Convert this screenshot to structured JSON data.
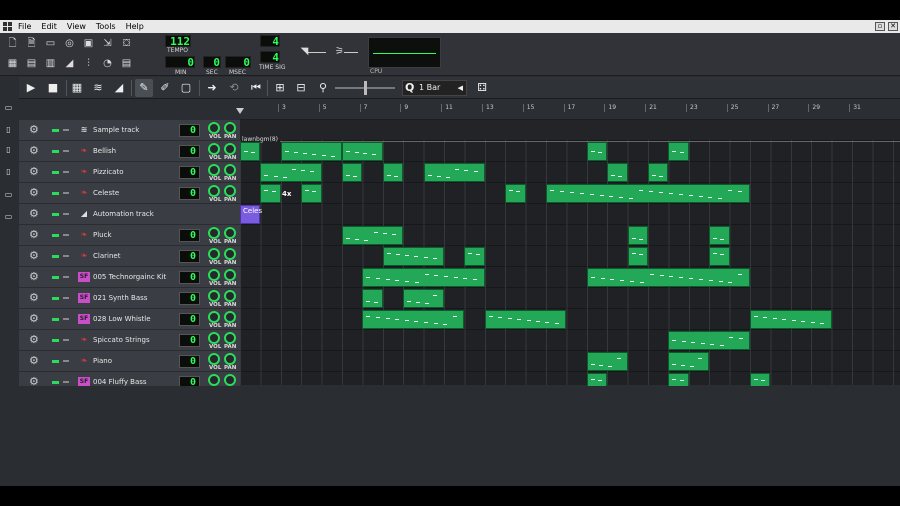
{
  "menubar": {
    "items": [
      "File",
      "Edit",
      "View",
      "Tools",
      "Help"
    ]
  },
  "transport": {
    "tempo": "112",
    "tempo_label": "TEMPO",
    "time_min": "0",
    "time_sec": "0",
    "time_msec": "0",
    "min_label": "MIN",
    "sec_label": "SEC",
    "msec_label": "MSEC",
    "timesig_num": "4",
    "timesig_den": "4",
    "timesig_label": "TIME SIG",
    "cpu_label": "CPU"
  },
  "song_editor": {
    "quantize_value": "1 Bar",
    "bar_numbers": [
      "3",
      "5",
      "7",
      "9",
      "11",
      "13",
      "15",
      "17",
      "19",
      "21",
      "23",
      "25",
      "27",
      "29",
      "31"
    ],
    "sample_clip_label": "lawnbgm(8)",
    "automation_clip_label": "Celes",
    "clip_repeat_label": "4x"
  },
  "tracks": [
    {
      "name": "Sample track",
      "icon": "waveform-icon",
      "volume": "0",
      "type": "sample"
    },
    {
      "name": "Bellish",
      "icon": "instrument-plugin-icon",
      "volume": "0",
      "type": "instrument"
    },
    {
      "name": "Pizzicato",
      "icon": "instrument-plugin-icon",
      "volume": "0",
      "type": "instrument"
    },
    {
      "name": "Celeste",
      "icon": "instrument-plugin-icon",
      "volume": "0",
      "type": "instrument"
    },
    {
      "name": "Automation track",
      "icon": "automation-icon",
      "volume": "",
      "type": "automation"
    },
    {
      "name": "Pluck",
      "icon": "instrument-plugin-icon",
      "volume": "0",
      "type": "instrument"
    },
    {
      "name": "Clarinet",
      "icon": "instrument-plugin-icon",
      "volume": "0",
      "type": "instrument"
    },
    {
      "name": "005 Technorgainc Kit",
      "icon": "soundfont-icon",
      "volume": "0",
      "type": "instrument"
    },
    {
      "name": "021 Synth Bass",
      "icon": "soundfont-icon",
      "volume": "0",
      "type": "instrument"
    },
    {
      "name": "028 Low Whistle",
      "icon": "soundfont-icon",
      "volume": "0",
      "type": "instrument"
    },
    {
      "name": "Spiccato Strings",
      "icon": "instrument-plugin-icon",
      "volume": "0",
      "type": "instrument"
    },
    {
      "name": "Piano",
      "icon": "instrument-plugin-icon",
      "volume": "0",
      "type": "instrument"
    },
    {
      "name": "004 Fluffy Bass",
      "icon": "soundfont-icon",
      "volume": "0",
      "type": "instrument"
    }
  ],
  "knob_labels": {
    "vol": "VOL",
    "pan": "PAN"
  },
  "colors": {
    "clip": "#23a857",
    "automation_clip": "#7b5ce0",
    "lcd_text": "#2bff5a",
    "soundfont_icon": "#c84fc8",
    "plugin_icon": "#e03a3a"
  }
}
